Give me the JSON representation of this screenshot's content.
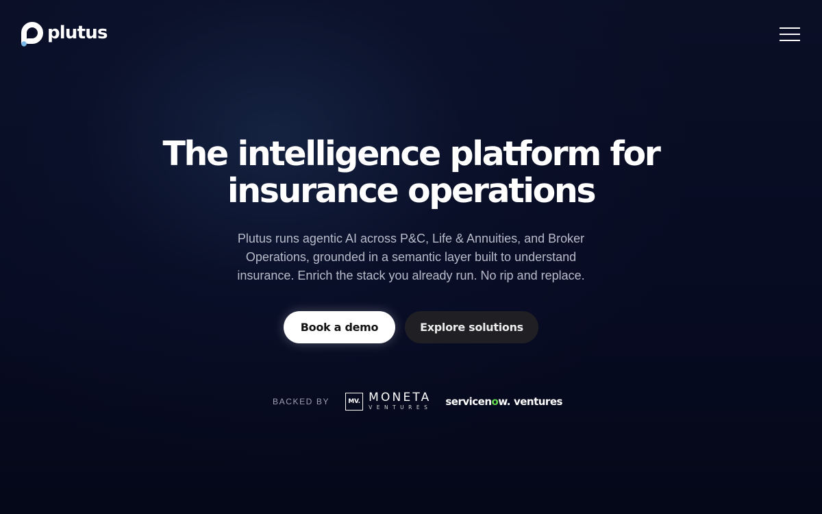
{
  "header": {
    "logo_text": "plutus",
    "menu_icon": "hamburger-menu-icon",
    "logo_icon": "plutus-logo-icon"
  },
  "hero": {
    "title": "The intelligence platform for insurance operations",
    "subtitle": "Plutus runs agentic AI across P&C, Life & Annuities, and Broker Operations, grounded in a semantic layer built to understand insurance. Enrich the stack you already run. No rip and replace."
  },
  "cta": {
    "primary_label": "Book a demo",
    "secondary_label": "Explore solutions"
  },
  "backers": {
    "label": "BACKED BY",
    "moneta": {
      "mark": "MV.",
      "name": "MONETA",
      "sub": "VENTURES"
    },
    "servicenow": {
      "part1": "servicen",
      "part2": "o",
      "part3": "w.",
      "part4": "ventures"
    }
  },
  "colors": {
    "background": "#070b22",
    "primary_button_bg": "#ffffff",
    "secondary_button_bg": "#202024",
    "subtitle_text": "#b9bccb",
    "servicenow_accent": "#62d84e",
    "logo_dot": "#7ab8e8"
  }
}
